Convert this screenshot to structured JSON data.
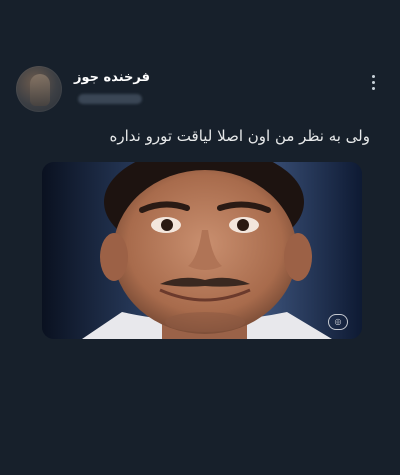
{
  "tweet": {
    "author": {
      "display_name": "فرخنده جوز"
    },
    "text": "ولی به نظر من اون اصلا لیاقت تورو نداره",
    "menu_icon": "more-vertical-icon",
    "media": {
      "watermark_icon": "broadcaster-logo-icon"
    }
  },
  "colors": {
    "background": "#17202b",
    "text": "#e7e9ea",
    "name": "#ffffff"
  }
}
